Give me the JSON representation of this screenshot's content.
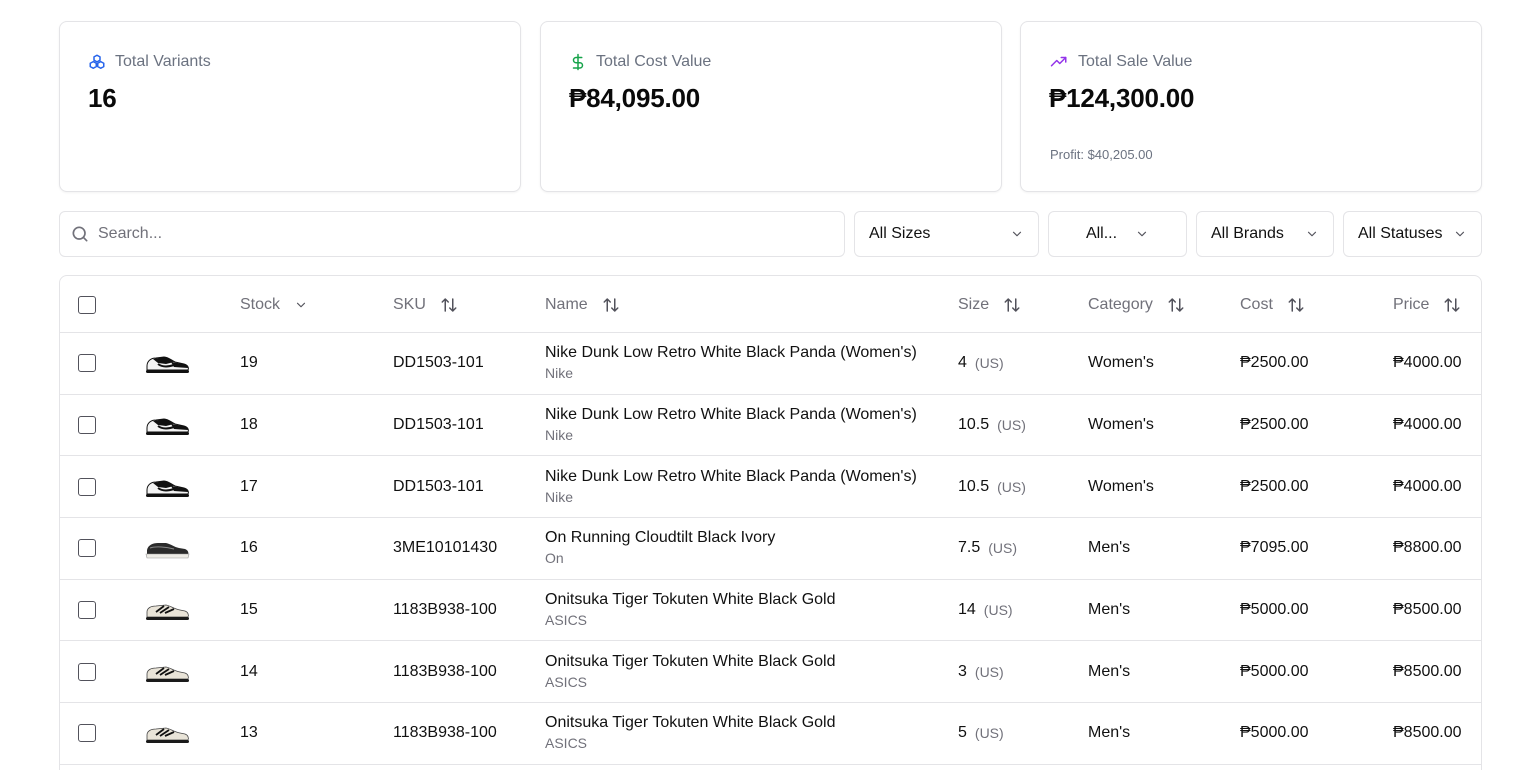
{
  "cards": [
    {
      "label": "Total Variants",
      "value": "16",
      "icon": "boxes-icon",
      "color": "#2563eb"
    },
    {
      "label": "Total Cost Value",
      "value": "₱84,095.00",
      "icon": "dollar-icon",
      "color": "#16a34a"
    },
    {
      "label": "Total Sale Value",
      "value": "₱124,300.00",
      "icon": "trending-up-icon",
      "color": "#9333ea",
      "sub": "Profit: $40,205.00"
    }
  ],
  "search": {
    "placeholder": "Search..."
  },
  "filters": {
    "sizes": "All Sizes",
    "category": "All...",
    "brands": "All Brands",
    "statuses": "All Statuses"
  },
  "columns": {
    "stock": "Stock",
    "sku": "SKU",
    "name": "Name",
    "size": "Size",
    "category": "Category",
    "cost": "Cost",
    "price": "Price"
  },
  "rows": [
    {
      "stock": "19",
      "sku": "DD1503-101",
      "name": "Nike Dunk Low Retro White Black Panda (Women's)",
      "brand": "Nike",
      "size": "4",
      "unit": "(US)",
      "category": "Women's",
      "cost": "₱2500.00",
      "price": "₱4000.00",
      "image": "panda"
    },
    {
      "stock": "18",
      "sku": "DD1503-101",
      "name": "Nike Dunk Low Retro White Black Panda (Women's)",
      "brand": "Nike",
      "size": "10.5",
      "unit": "(US)",
      "category": "Women's",
      "cost": "₱2500.00",
      "price": "₱4000.00",
      "image": "panda"
    },
    {
      "stock": "17",
      "sku": "DD1503-101",
      "name": "Nike Dunk Low Retro White Black Panda (Women's)",
      "brand": "Nike",
      "size": "10.5",
      "unit": "(US)",
      "category": "Women's",
      "cost": "₱2500.00",
      "price": "₱4000.00",
      "image": "panda"
    },
    {
      "stock": "16",
      "sku": "3ME10101430",
      "name": "On Running Cloudtilt Black Ivory",
      "brand": "On",
      "size": "7.5",
      "unit": "(US)",
      "category": "Men's",
      "cost": "₱7095.00",
      "price": "₱8800.00",
      "image": "cloudtilt"
    },
    {
      "stock": "15",
      "sku": "1183B938-100",
      "name": "Onitsuka Tiger Tokuten White Black Gold",
      "brand": "ASICS",
      "size": "14",
      "unit": "(US)",
      "category": "Men's",
      "cost": "₱5000.00",
      "price": "₱8500.00",
      "image": "tokuten"
    },
    {
      "stock": "14",
      "sku": "1183B938-100",
      "name": "Onitsuka Tiger Tokuten White Black Gold",
      "brand": "ASICS",
      "size": "3",
      "unit": "(US)",
      "category": "Men's",
      "cost": "₱5000.00",
      "price": "₱8500.00",
      "image": "tokuten"
    },
    {
      "stock": "13",
      "sku": "1183B938-100",
      "name": "Onitsuka Tiger Tokuten White Black Gold",
      "brand": "ASICS",
      "size": "5",
      "unit": "(US)",
      "category": "Men's",
      "cost": "₱5000.00",
      "price": "₱8500.00",
      "image": "tokuten"
    }
  ]
}
